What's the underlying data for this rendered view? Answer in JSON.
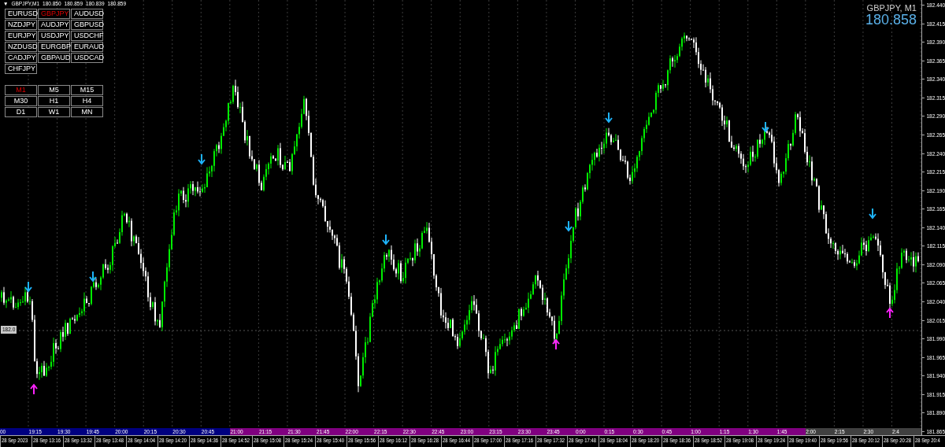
{
  "header": {
    "menu_glyph": "▼",
    "symbol": "GBPJPY,M1",
    "prices": [
      "180.850",
      "180.859",
      "180.839",
      "180.859"
    ]
  },
  "symbols": [
    {
      "label": "EURUSD",
      "selected": false
    },
    {
      "label": "GBPJPY",
      "selected": true
    },
    {
      "label": "AUDUSD",
      "selected": false
    },
    {
      "label": "NZDJPY",
      "selected": false
    },
    {
      "label": "AUDJPY",
      "selected": false
    },
    {
      "label": "GBPUSD",
      "selected": false
    },
    {
      "label": "EURJPY",
      "selected": false
    },
    {
      "label": "USDJPY",
      "selected": false
    },
    {
      "label": "USDCHF",
      "selected": false
    },
    {
      "label": "NZDUSD",
      "selected": false
    },
    {
      "label": "EURGBP",
      "selected": false
    },
    {
      "label": "EURAUD",
      "selected": false
    },
    {
      "label": "CADJPY",
      "selected": false
    },
    {
      "label": "GBPAUD",
      "selected": false
    },
    {
      "label": "USDCAD",
      "selected": false
    },
    {
      "label": "CHFJPY",
      "selected": false
    }
  ],
  "timeframes": [
    {
      "label": "M1",
      "selected": true
    },
    {
      "label": "M5",
      "selected": false
    },
    {
      "label": "M15",
      "selected": false
    },
    {
      "label": "M30",
      "selected": false
    },
    {
      "label": "H1",
      "selected": false
    },
    {
      "label": "H4",
      "selected": false
    },
    {
      "label": "D1",
      "selected": false
    },
    {
      "label": "W1",
      "selected": false
    },
    {
      "label": "MN",
      "selected": false
    }
  ],
  "ticker": {
    "title": "GBPJPY, M1",
    "price": "180.858"
  },
  "price_axis": [
    "182.440",
    "182.415",
    "182.390",
    "182.365",
    "182.340",
    "182.315",
    "182.290",
    "182.265",
    "182.240",
    "182.215",
    "182.190",
    "182.165",
    "182.140",
    "182.115",
    "182.090",
    "182.065",
    "182.040",
    "182.015",
    "181.990",
    "181.965",
    "181.940",
    "181.915",
    "181.890",
    "181.865"
  ],
  "price_marker": "182.0",
  "sessions": [
    {
      "color": "#000080",
      "labels": [
        "00",
        "19:15",
        "19:30",
        "19:45",
        "20:00",
        "20:15",
        "20:30",
        "20:45"
      ]
    },
    {
      "color": "#800080",
      "labels": [
        "21:00",
        "21:15",
        "21:30",
        "21:45",
        "22:00",
        "22:15",
        "22:30",
        "22:45",
        "23:00",
        "23:15",
        "23:30",
        "23:45",
        "0:00",
        "0:15",
        "0:30",
        "0:45",
        "1:00",
        "1:15",
        "1:30",
        "1:45"
      ]
    },
    {
      "color": "#404040",
      "labels": [
        "2:00",
        "2:15",
        "2:30",
        "2:4"
      ]
    }
  ],
  "dates": [
    "28 Sep 2023",
    "28 Sep 13:16",
    "28 Sep 13:32",
    "28 Sep 13:48",
    "28 Sep 14:04",
    "28 Sep 14:20",
    "28 Sep 14:36",
    "28 Sep 14:52",
    "28 Sep 15:08",
    "28 Sep 15:24",
    "28 Sep 15:40",
    "28 Sep 15:56",
    "28 Sep 16:12",
    "28 Sep 16:28",
    "28 Sep 16:44",
    "28 Sep 17:00",
    "28 Sep 17:16",
    "28 Sep 17:32",
    "28 Sep 17:48",
    "28 Sep 18:04",
    "28 Sep 18:20",
    "28 Sep 18:36",
    "28 Sep 18:52",
    "28 Sep 19:08",
    "28 Sep 19:24",
    "28 Sep 19:40",
    "28 Sep 19:56",
    "28 Sep 20:12",
    "28 Sep 20:28",
    "28 Sep 20:4"
  ]
}
